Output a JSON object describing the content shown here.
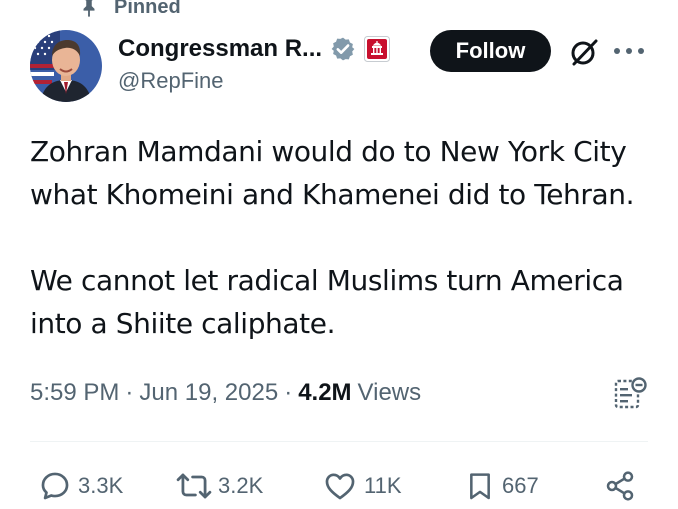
{
  "pinned": {
    "label": "Pinned",
    "icon": "pin-icon"
  },
  "author": {
    "display_name": "Congressman R...",
    "handle": "@RepFine",
    "verified_icon": "verified-badge-icon",
    "affiliation_icon": "congress-affiliation-icon",
    "avatar": "avatar"
  },
  "header": {
    "follow_label": "Follow",
    "grok_icon": "grok-icon",
    "more_icon": "more-options-icon"
  },
  "tweet": {
    "paragraphs": [
      [
        "Zohran Mamdani would do to New York City",
        "what Khomeini and Khamenei did to Tehran."
      ],
      [
        "We cannot let radical Muslims turn America",
        "into a Shiite caliphate."
      ]
    ],
    "time": "5:59 PM",
    "date": "Jun 19, 2025",
    "views_count": "4.2M",
    "views_label": "Views"
  },
  "actions": {
    "replies": "3.3K",
    "reposts": "3.2K",
    "likes": "11K",
    "bookmarks": "667"
  },
  "colors": {
    "text_primary": "#0f1419",
    "text_secondary": "#536471",
    "verified_gray": "#829aab",
    "affiliation_red": "#c8102e",
    "divider": "#eff3f4"
  }
}
